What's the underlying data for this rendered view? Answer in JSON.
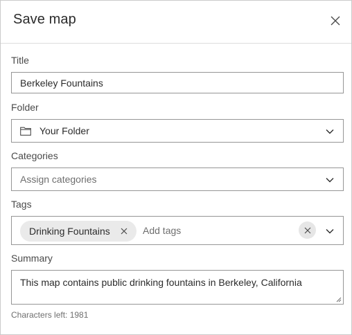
{
  "dialog": {
    "title": "Save map"
  },
  "title_field": {
    "label": "Title",
    "value": "Berkeley Fountains"
  },
  "folder_field": {
    "label": "Folder",
    "value": "Your Folder",
    "icon": "folder-icon"
  },
  "categories_field": {
    "label": "Categories",
    "placeholder": "Assign categories"
  },
  "tags_field": {
    "label": "Tags",
    "tags": [
      "Drinking Fountains"
    ],
    "placeholder": "Add tags"
  },
  "summary_field": {
    "label": "Summary",
    "value": "This map contains public drinking fountains in Berkeley, California",
    "characters_left": "Characters left: 1981"
  },
  "colors": {
    "border": "#959595",
    "chip_bg": "#eaeaea",
    "text": "#2b2b2b",
    "muted": "#6e6e6e"
  }
}
